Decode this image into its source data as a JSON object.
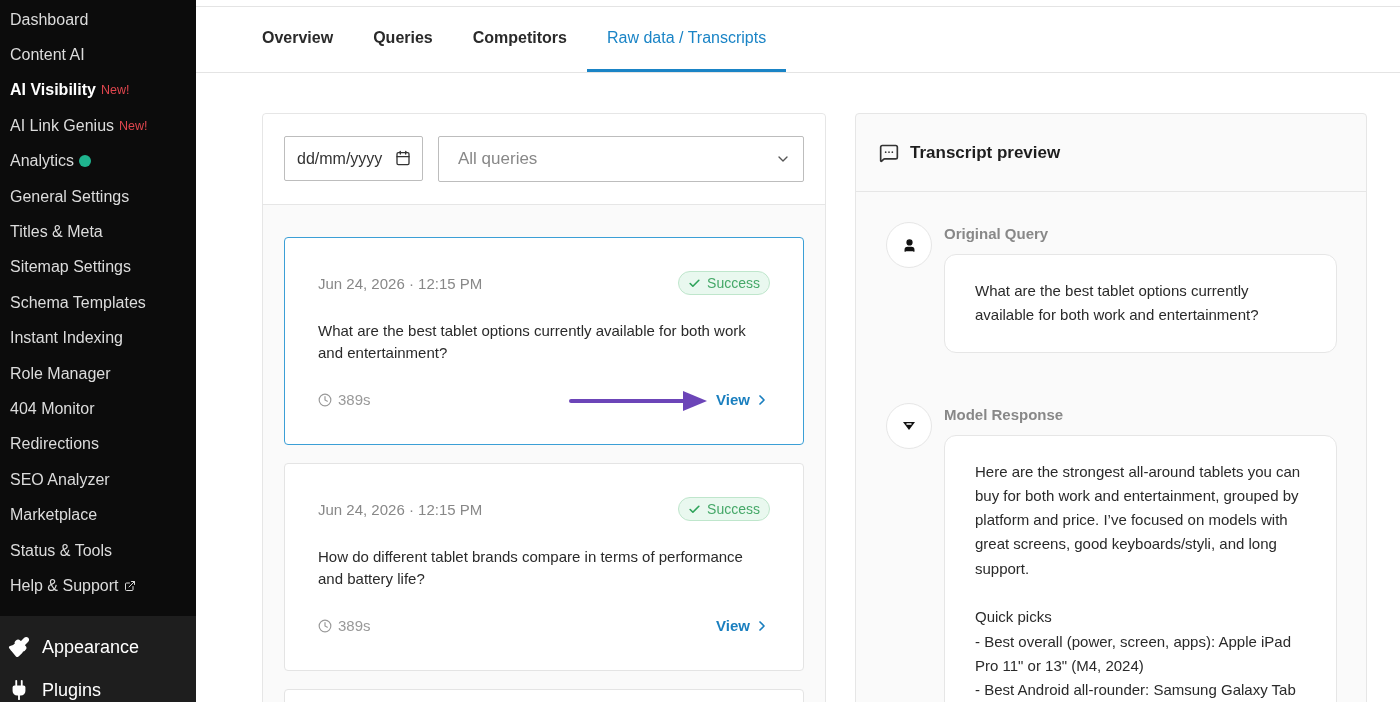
{
  "sidebar": {
    "items": [
      {
        "label": "Dashboard",
        "selected": false
      },
      {
        "label": "Content AI",
        "selected": false
      },
      {
        "label": "AI Visibility",
        "selected": true,
        "badge": "New!"
      },
      {
        "label": "AI Link Genius",
        "selected": false,
        "badge": "New!"
      },
      {
        "label": "Analytics",
        "selected": false,
        "dot": true
      },
      {
        "label": "General Settings",
        "selected": false
      },
      {
        "label": "Titles & Meta",
        "selected": false
      },
      {
        "label": "Sitemap Settings",
        "selected": false
      },
      {
        "label": "Schema Templates",
        "selected": false
      },
      {
        "label": "Instant Indexing",
        "selected": false
      },
      {
        "label": "Role Manager",
        "selected": false
      },
      {
        "label": "404 Monitor",
        "selected": false
      },
      {
        "label": "Redirections",
        "selected": false
      },
      {
        "label": "SEO Analyzer",
        "selected": false
      },
      {
        "label": "Marketplace",
        "selected": false
      },
      {
        "label": "Status & Tools",
        "selected": false
      },
      {
        "label": "Help & Support",
        "selected": false,
        "external": true
      }
    ],
    "menu": [
      {
        "label": "Appearance",
        "kind": "brush"
      },
      {
        "label": "Plugins",
        "kind": "plug"
      }
    ]
  },
  "tabs": [
    {
      "label": "Overview",
      "selected": false
    },
    {
      "label": "Queries",
      "selected": false
    },
    {
      "label": "Competitors",
      "selected": false
    },
    {
      "label": "Raw data / Transcripts",
      "selected": true
    }
  ],
  "filters": {
    "date": {
      "placeholder": "dd/mm/yyyy"
    },
    "query_select": {
      "value": "All queries"
    }
  },
  "runs": [
    {
      "date": "Jun 24, 2026 · 12:15 PM",
      "status": "Success",
      "query": "What are the best tablet options currently available for both work and entertainment?",
      "duration": "389s",
      "action": "View",
      "selected": true,
      "arrow": true
    },
    {
      "date": "Jun 24, 2026 · 12:15 PM",
      "status": "Success",
      "query": "How do different tablet brands compare in terms of performance and battery life?",
      "duration": "389s",
      "action": "View",
      "selected": false
    },
    {
      "selected": false
    }
  ],
  "preview": {
    "title": "Transcript preview",
    "sections": [
      {
        "kind": "user",
        "label": "Original Query",
        "text": "What are the best tablet options currently available for both work and entertainment?"
      },
      {
        "kind": "model",
        "label": "Model Response",
        "text": "Here are the strongest all-around tablets you can buy for both work and entertainment, grouped by platform and price. I’ve focused on models with great screens, good keyboards/styli, and long support.\n\nQuick picks\n- Best overall (power, screen, apps): Apple iPad Pro 11\" or 13\" (M4, 2024)\n- Best Android all-rounder: Samsung Galaxy Tab"
      }
    ]
  }
}
